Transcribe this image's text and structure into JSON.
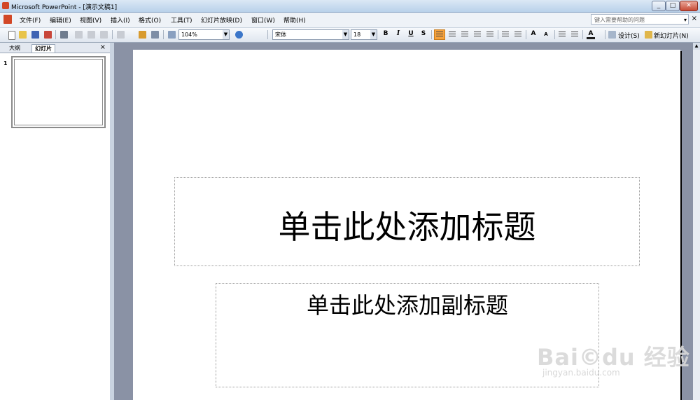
{
  "window": {
    "title": "Microsoft PowerPoint - [演示文稿1]",
    "minimize": "_",
    "restore": "□",
    "close": "✕"
  },
  "menu": {
    "items": [
      "文件(F)",
      "编辑(E)",
      "视图(V)",
      "插入(I)",
      "格式(O)",
      "工具(T)",
      "幻灯片放映(D)",
      "窗口(W)",
      "帮助(H)"
    ],
    "help_placeholder": "键入需要帮助的问题",
    "close": "×"
  },
  "toolbar": {
    "zoom": "104%",
    "font_name": "宋体",
    "font_size": "18",
    "bold": "B",
    "italic": "I",
    "underline": "U",
    "shadow": "S",
    "grow_font": "A",
    "shrink_font": "A",
    "font_color": "A",
    "design_label": "设计(S)",
    "new_slide_label": "新幻灯片(N)"
  },
  "left_pane": {
    "tabs": [
      "大纲",
      "幻灯片"
    ],
    "active_tab": "幻灯片",
    "close": "×",
    "slide_number": "1"
  },
  "slide": {
    "title_placeholder": "单击此处添加标题",
    "subtitle_placeholder": "单击此处添加副标题"
  },
  "watermark": {
    "brand": "Bai©du 经验",
    "url": "jingyan.baidu.com"
  },
  "colors": {
    "accent": "#f7a23b",
    "titlebar": "#c9dcf0",
    "stage": "#8a92a5"
  }
}
